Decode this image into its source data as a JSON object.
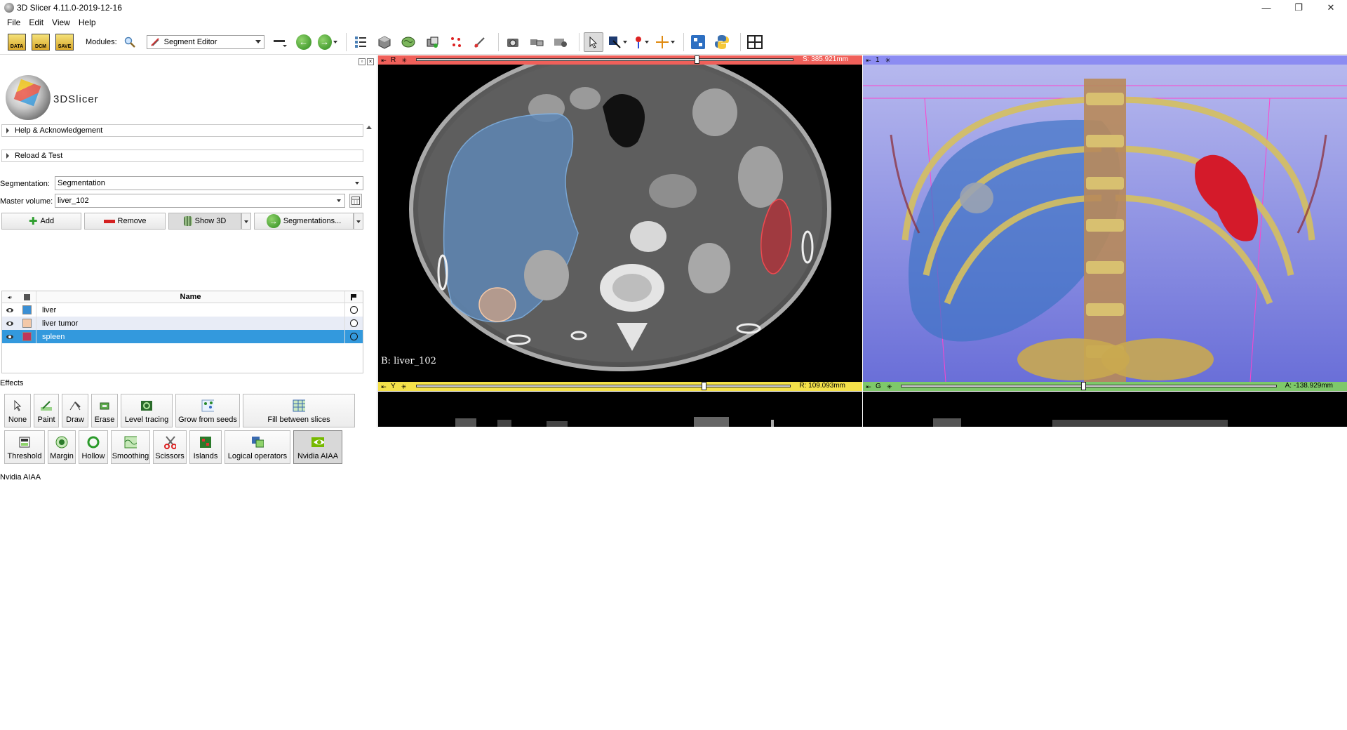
{
  "window": {
    "title": "3D Slicer 4.11.0-2019-12-16",
    "minimize": "—",
    "maximize": "❐",
    "close": "✕"
  },
  "menu": [
    {
      "label": "File",
      "underline": "F"
    },
    {
      "label": "Edit",
      "underline": "E"
    },
    {
      "label": "View",
      "underline": "V"
    },
    {
      "label": "Help",
      "underline": "H"
    }
  ],
  "toolbar": {
    "data_label": "DATA",
    "dcm_label": "DCM",
    "save_label": "SAVE",
    "modules_label": "Modules:",
    "module_selected": "Segment Editor"
  },
  "left_panel": {
    "logo_text": "3DSlicer",
    "sections": {
      "help": "Help & Acknowledgement",
      "reload": "Reload & Test"
    },
    "segmentation_label": "Segmentation:",
    "segmentation_value": "Segmentation",
    "master_volume_label": "Master volume:",
    "master_volume_value": "liver_102",
    "buttons": {
      "add": "Add",
      "remove": "Remove",
      "show3d": "Show 3D",
      "segmentations": "Segmentations..."
    },
    "table": {
      "name_header": "Name",
      "rows": [
        {
          "name": "liver",
          "color": "#3b8fd4"
        },
        {
          "name": "liver tumor",
          "color": "#f3c8a8"
        },
        {
          "name": "spleen",
          "color": "#c0365a"
        }
      ]
    },
    "effects_label": "Effects",
    "effects_row1": [
      "None",
      "Paint",
      "Draw",
      "Erase",
      "Level tracing",
      "Grow from seeds",
      "Fill between slices"
    ],
    "effects_row2": [
      "Threshold",
      "Margin",
      "Hollow",
      "Smoothing",
      "Scissors",
      "Islands",
      "Logical operators",
      "Nvidia AIAA"
    ],
    "active_effect": "Nvidia AIAA"
  },
  "views": {
    "red": {
      "label": "R",
      "offset": "S: 385.921mm",
      "annotation": "B: liver_102",
      "color": "#f0605a"
    },
    "threed": {
      "label": "1",
      "color": "#8c8cf2"
    },
    "yellow": {
      "label": "Y",
      "offset": "R: 109.093mm",
      "color": "#f4e14a"
    },
    "green": {
      "label": "G",
      "offset": "A: -138.929mm",
      "color": "#7ec86a"
    }
  }
}
